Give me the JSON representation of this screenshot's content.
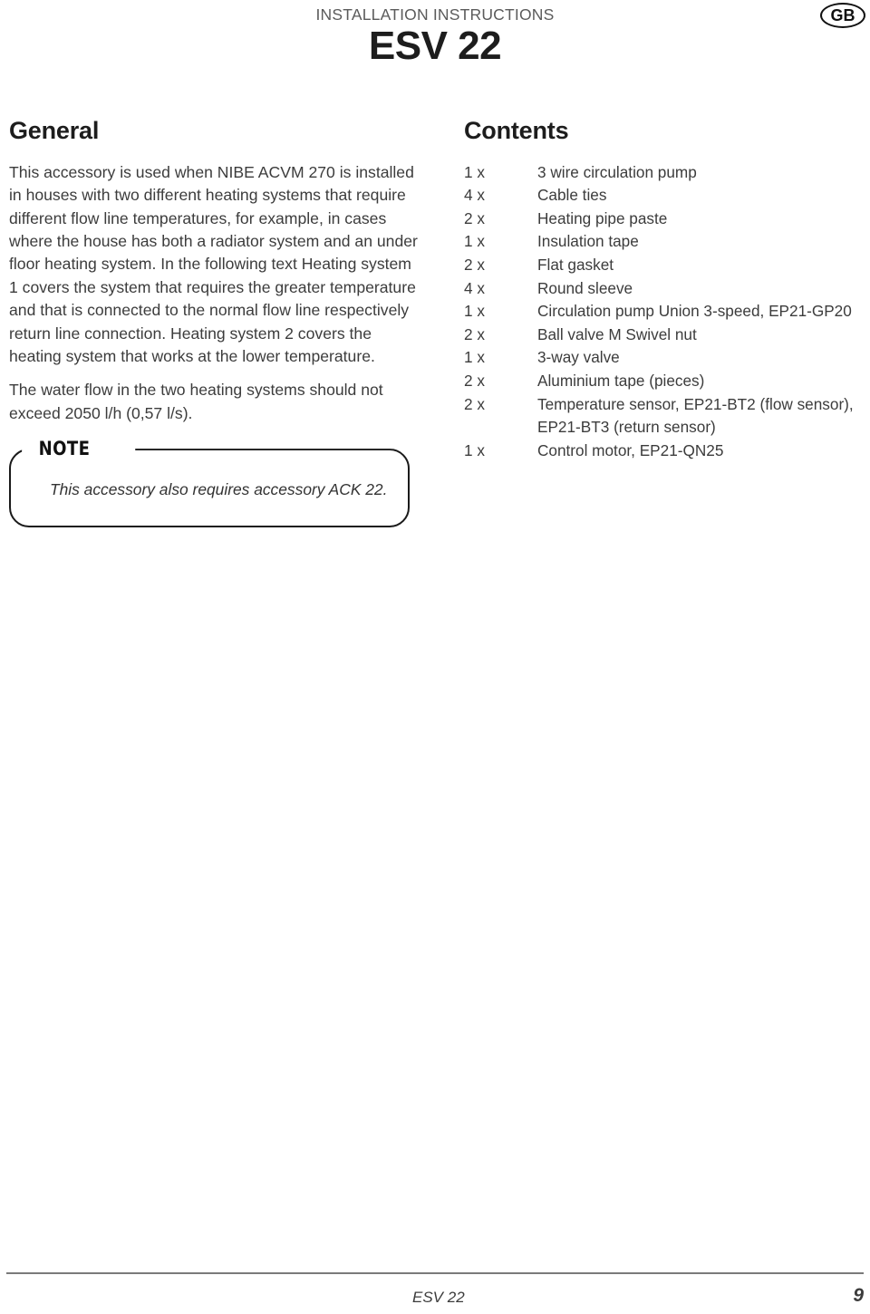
{
  "header": {
    "kicker": "INSTALLATION INSTRUCTIONS",
    "title": "ESV 22",
    "locale_badge": "GB"
  },
  "general": {
    "heading": "General",
    "paragraphs": [
      "This accessory is used when NIBE ACVM 270 is installed in houses with two different heating systems that require different flow line temperatures, for example, in cases where the house has both a radiator system and an under floor heating system. In the following text Heating system 1 covers the system that requires the greater temperature and that is connected to the normal flow line respectively return line connection. Heating system 2 covers the heating system that works at the lower temperature.",
      "The water flow in the two heating systems should not exceed 2050 l/h (0,57 l/s)."
    ],
    "note": {
      "label": "NOTE",
      "text": "This accessory also requires accessory ACK 22."
    }
  },
  "contents": {
    "heading": "Contents",
    "items": [
      {
        "qty": "1 x",
        "desc": "3 wire circulation pump"
      },
      {
        "qty": "4 x",
        "desc": "Cable ties"
      },
      {
        "qty": "2 x",
        "desc": "Heating pipe paste"
      },
      {
        "qty": "1 x",
        "desc": "Insulation tape"
      },
      {
        "qty": "2 x",
        "desc": "Flat gasket"
      },
      {
        "qty": "4 x",
        "desc": "Round sleeve"
      },
      {
        "qty": "1 x",
        "desc": "Circulation pump Union 3-speed, EP21-GP20"
      },
      {
        "qty": "2 x",
        "desc": "Ball valve M Swivel nut"
      },
      {
        "qty": "1 x",
        "desc": "3-way valve"
      },
      {
        "qty": "2 x",
        "desc": "Aluminium tape (pieces)"
      },
      {
        "qty": "2 x",
        "desc": "Temperature sensor, EP21-BT2 (flow sensor), EP21-BT3 (return sensor)"
      },
      {
        "qty": "1 x",
        "desc": "Control motor, EP21-QN25"
      }
    ]
  },
  "footer": {
    "document": "ESV 22",
    "page_number": "9"
  },
  "colors": {
    "text": "#3c3c3c",
    "heading": "#1d1d1d",
    "rule": "#7a7a7a",
    "note_border": "#1a1a1a"
  }
}
